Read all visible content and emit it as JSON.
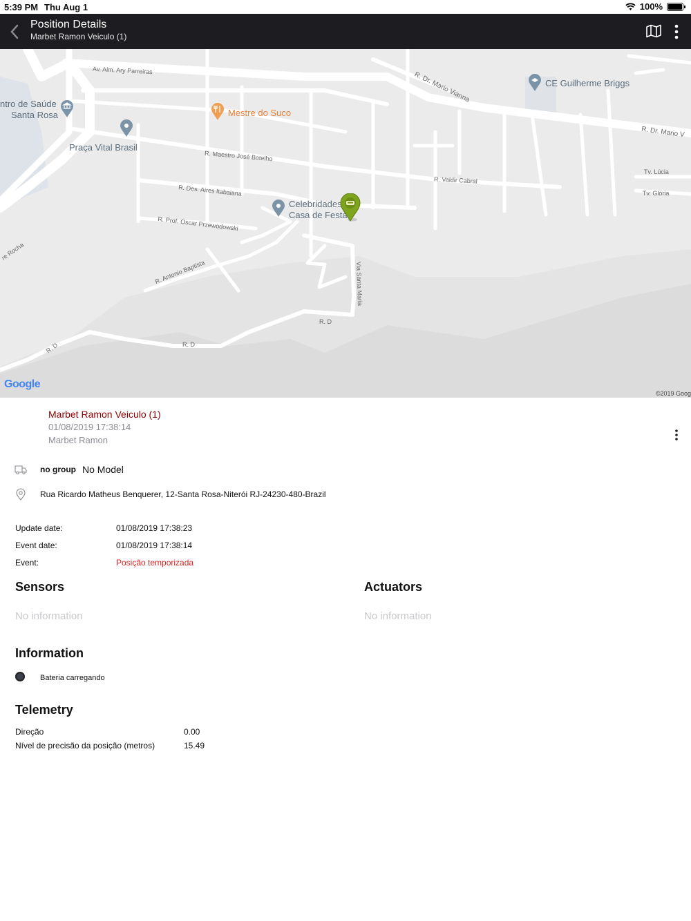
{
  "status_bar": {
    "time": "5:39 PM",
    "date": "Thu Aug 1",
    "battery": "100%"
  },
  "header": {
    "title": "Position Details",
    "subtitle": "Marbet Ramon Veiculo (1)"
  },
  "map": {
    "streets": [
      "Av. Alm. Ary Parreiras",
      "R. Dr. Mario Vianna",
      "R. Dr. Mario V",
      "R. Maestro José Botelho",
      "R. Valdir Cabral",
      "Tv. Lúcia",
      "Tv. Glória",
      "R. Des. Aires Itabaiana",
      "R. Prof. Oscar Przewodowski",
      "R. Antonio Baptista",
      "Via Santa Maria",
      "R. D",
      "R. D",
      "R. D",
      "re Rocha"
    ],
    "pois": {
      "ce": "CE Guilherme Briggs",
      "health_1": "ntro de Saúde",
      "health_2": "Santa Rosa",
      "juice": "Mestre do Suco",
      "square": "Praça Vital Brasil",
      "party_1": "Celebridades",
      "party_2": "Casa de Festa"
    },
    "provider": "Google",
    "copyright": "©2019 Goog"
  },
  "vehicle": {
    "name": "Marbet Ramon Veiculo (1)",
    "timestamp": "01/08/2019 17:38:14",
    "owner": "Marbet Ramon"
  },
  "group": {
    "name": "no group",
    "model": "No Model"
  },
  "address": "Rua Ricardo Matheus Benquerer, 12-Santa Rosa-Niterói RJ-24230-480-Brazil",
  "details": {
    "update_label": "Update date:",
    "update_value": "01/08/2019 17:38:23",
    "event_date_label": "Event date:",
    "event_date_value": "01/08/2019 17:38:14",
    "event_label": "Event:",
    "event_value": "Posição temporizada"
  },
  "sensors": {
    "title": "Sensors",
    "empty": "No information"
  },
  "actuators": {
    "title": "Actuators",
    "empty": "No information"
  },
  "information": {
    "title": "Information",
    "items": [
      {
        "label": "Bateria carregando"
      }
    ]
  },
  "telemetry": {
    "title": "Telemetry",
    "rows": [
      {
        "label": "Direção",
        "value": "0.00"
      },
      {
        "label": "Nível de precisão da posição (metros)",
        "value": "15.49"
      }
    ]
  },
  "colors": {
    "navbar": "#1d1d21",
    "vehicle_name": "#8b0000",
    "event": "#e02020",
    "marker": "#7fa51f"
  }
}
